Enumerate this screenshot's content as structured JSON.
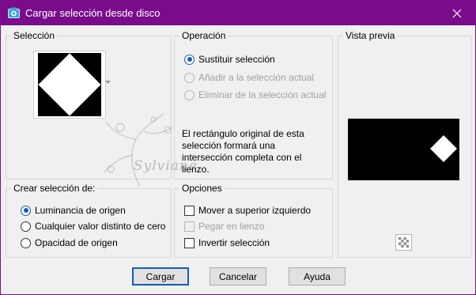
{
  "window": {
    "title": "Cargar selección desde disco",
    "accent": "#7a0c8c"
  },
  "seleccion": {
    "label": "Selección"
  },
  "operacion": {
    "label": "Operación",
    "options": [
      {
        "label": "Sustituir selección",
        "checked": true,
        "disabled": false
      },
      {
        "label": "Añadir a la selección actual",
        "checked": false,
        "disabled": true
      },
      {
        "label": "Eliminar de la selección actual",
        "checked": false,
        "disabled": true
      }
    ],
    "info": "El rectángulo original de esta selección formará una intersección completa con el lienzo."
  },
  "vista_previa": {
    "label": "Vista previa"
  },
  "crear": {
    "label": "Crear selección de:",
    "options": [
      {
        "label": "Luminancia de origen",
        "checked": true
      },
      {
        "label": "Cualquier valor distinto de cero",
        "checked": false
      },
      {
        "label": "Opacidad de origen",
        "checked": false
      }
    ]
  },
  "opciones": {
    "label": "Opciones",
    "items": [
      {
        "label": "Mover a superior izquierdo",
        "checked": false,
        "disabled": false
      },
      {
        "label": "Pegar en lienzo",
        "checked": false,
        "disabled": true
      },
      {
        "label": "Invertir selección",
        "checked": false,
        "disabled": false
      }
    ]
  },
  "buttons": {
    "ok": "Cargar",
    "cancel": "Cancelar",
    "help": "Ayuda"
  },
  "watermark": "Sylviane"
}
